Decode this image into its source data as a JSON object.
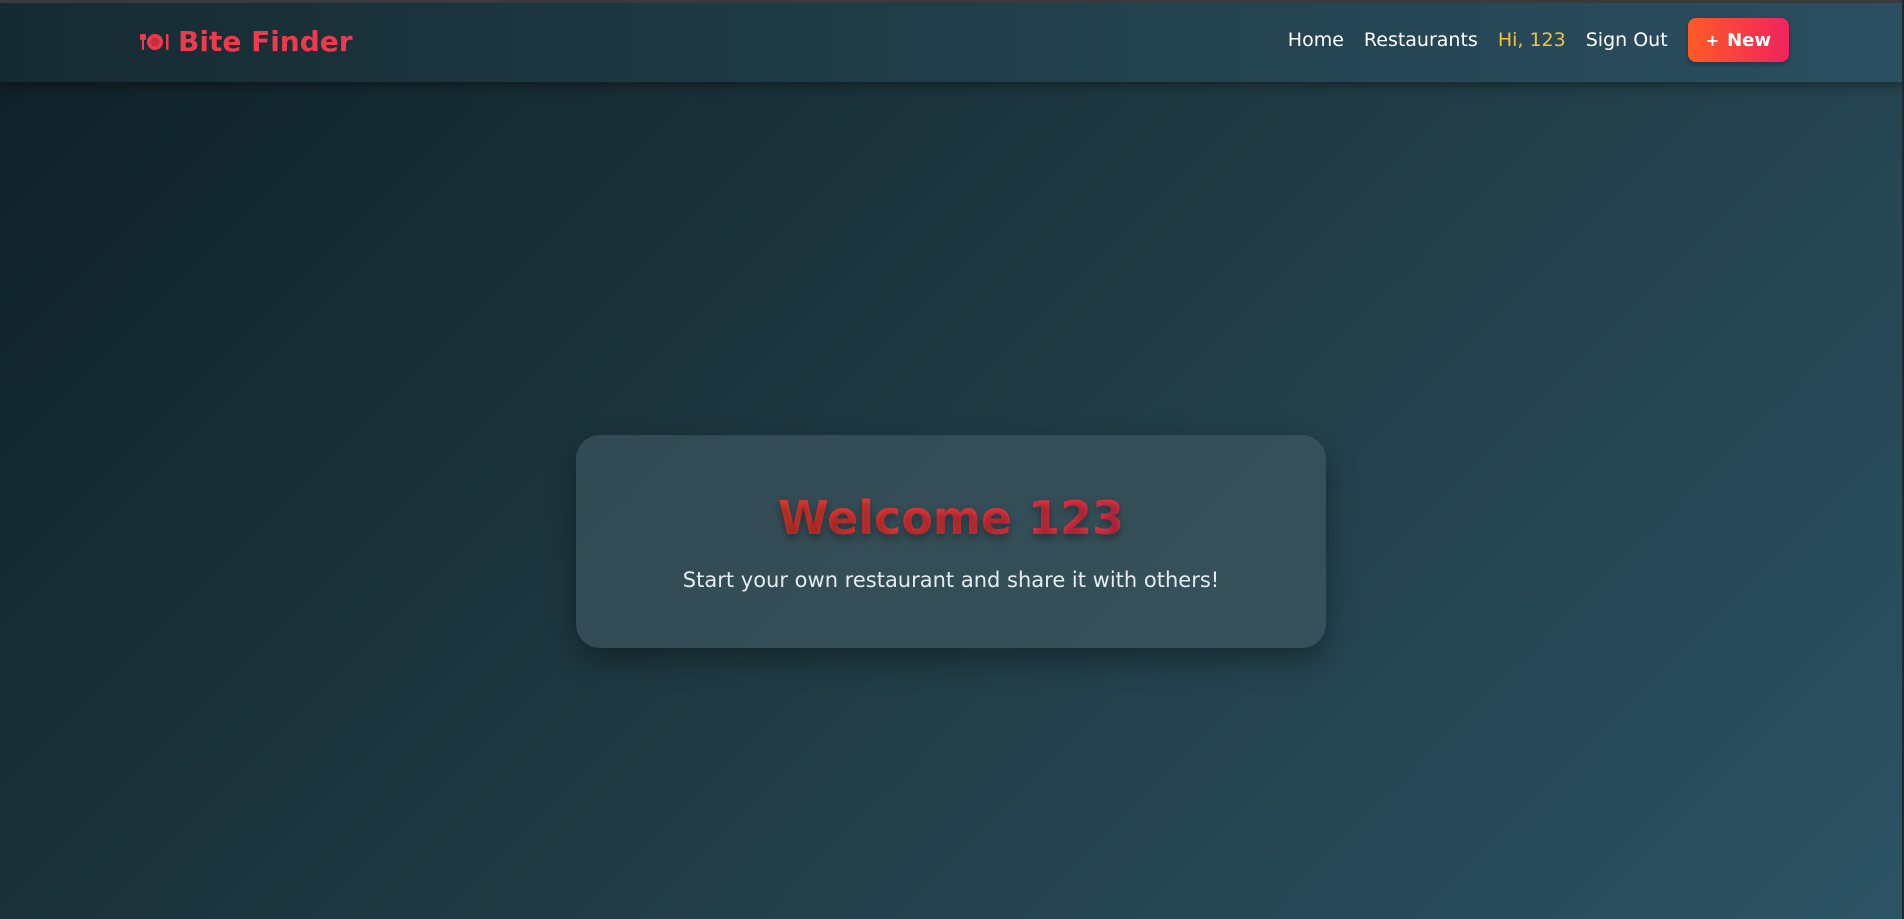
{
  "navbar": {
    "brand_icon": "plate-utensils-icon",
    "brand_label": "Bite Finder",
    "links": {
      "home": "Home",
      "restaurants": "Restaurants",
      "greeting": "Hi, 123",
      "sign_out": "Sign Out"
    },
    "new_button": {
      "icon": "plus-icon",
      "plus": "+",
      "label": "New"
    }
  },
  "main": {
    "welcome": "Welcome 123",
    "subtitle": "Start your own restaurant and share it with others!"
  },
  "colors": {
    "brand": "#ee3a4c",
    "greeting": "#f5c23c",
    "button_start": "#ff5a26",
    "button_end": "#f0235e"
  }
}
